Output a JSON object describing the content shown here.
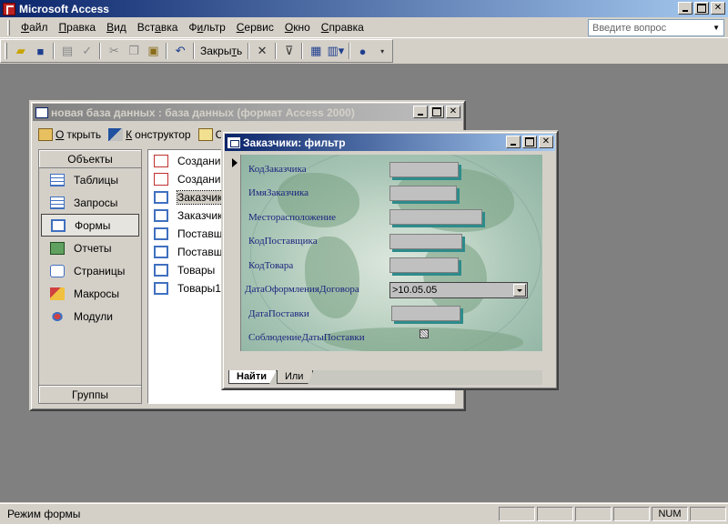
{
  "app": {
    "title": "Microsoft Access"
  },
  "menu": {
    "items": [
      {
        "pre": "",
        "ul": "Ф",
        "post": "айл"
      },
      {
        "pre": "",
        "ul": "П",
        "post": "равка"
      },
      {
        "pre": "",
        "ul": "В",
        "post": "ид"
      },
      {
        "pre": "Вст",
        "ul": "а",
        "post": "вка"
      },
      {
        "pre": "Ф",
        "ul": "и",
        "post": "льтр"
      },
      {
        "pre": "",
        "ul": "С",
        "post": "ервис"
      },
      {
        "pre": "",
        "ul": "О",
        "post": "кно"
      },
      {
        "pre": "",
        "ul": "С",
        "post": "правка"
      }
    ],
    "ask_placeholder": "Введите вопрос"
  },
  "toolbar": {
    "close_label_pre": "Закры",
    "close_label_ul": "т",
    "close_label_post": "ь"
  },
  "db_window": {
    "title": "новая база данных : база данных (формат Access 2000)",
    "btn_open_ul": "О",
    "btn_open_rest": "ткрыть",
    "btn_design_ul": "К",
    "btn_design_rest": "онструктор",
    "btn_create": "Со",
    "objects_header": "Объекты",
    "groups_footer": "Группы",
    "objects": [
      "Таблицы",
      "Запросы",
      "Формы",
      "Отчеты",
      "Страницы",
      "Макросы",
      "Модули"
    ],
    "list": [
      "Создание",
      "Создание",
      "Заказчик",
      "Заказчик",
      "Поставщ",
      "Поставщ",
      "Товары",
      "Товары1"
    ]
  },
  "filter_window": {
    "title": "Заказчики: фильтр",
    "fields": [
      "КодЗаказчика",
      "ИмяЗаказчика",
      "Месторасположение",
      "КодПоставщика",
      "КодТовара",
      "ДатаОформленияДоговора",
      "ДатаПоставки",
      "СоблюдениеДатыПоставки"
    ],
    "date_filter_value": ">10.05.05",
    "tab_find": "Найти",
    "tab_or": "Или"
  },
  "status": {
    "mode": "Режим формы",
    "num": "NUM"
  }
}
